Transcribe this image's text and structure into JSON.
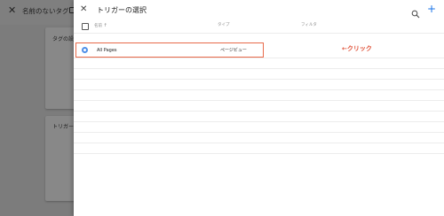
{
  "background_editor": {
    "close_icon": "close-icon",
    "tag_name": "名前のないタグ",
    "card1_label": "タグの設定",
    "card2_label": "トリガー"
  },
  "panel": {
    "title": "トリガーの選択",
    "close_icon": "close-icon",
    "search_icon": "search-icon",
    "add_label": "+",
    "columns": {
      "name": "名前",
      "sort_symbol": "↑",
      "type": "タイプ",
      "filter": "フィルタ"
    },
    "triggers": [
      {
        "name": "All Pages",
        "type": "ページビュー",
        "icon": "pageview-icon",
        "icon_color": "#4f8fe8"
      }
    ]
  },
  "annotation": {
    "text": "←クリック",
    "color": "#e0533a"
  }
}
